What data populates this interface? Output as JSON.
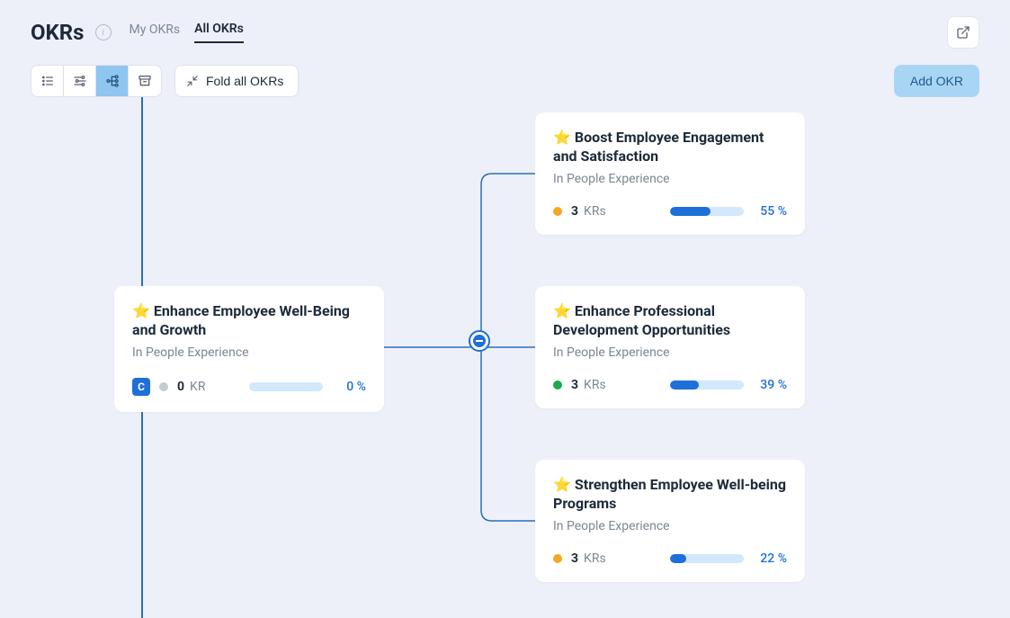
{
  "header": {
    "title": "OKRs",
    "tabs": {
      "my": "My OKRs",
      "all": "All OKRs"
    }
  },
  "toolbar": {
    "fold_label": "Fold all OKRs",
    "add_label": "Add OKR"
  },
  "parent": {
    "title": "Enhance Employee Well-Being and Growth",
    "subtitle": "In People Experience",
    "avatar_letter": "C",
    "status_color": "gray",
    "kr_count": "0",
    "kr_label": "KR",
    "progress_pct": 0,
    "pct_text": "0 %"
  },
  "children": [
    {
      "title": "Boost Employee Engagement and Satisfaction",
      "subtitle": "In People Experience",
      "status_color": "orange",
      "kr_count": "3",
      "kr_label": "KRs",
      "progress_pct": 55,
      "pct_text": "55 %"
    },
    {
      "title": "Enhance Professional Development Opportunities",
      "subtitle": "In People Experience",
      "status_color": "green",
      "kr_count": "3",
      "kr_label": "KRs",
      "progress_pct": 39,
      "pct_text": "39 %"
    },
    {
      "title": "Strengthen Employee Well-being Programs",
      "subtitle": "In People Experience",
      "status_color": "orange",
      "kr_count": "3",
      "kr_label": "KRs",
      "progress_pct": 22,
      "pct_text": "22 %"
    }
  ]
}
